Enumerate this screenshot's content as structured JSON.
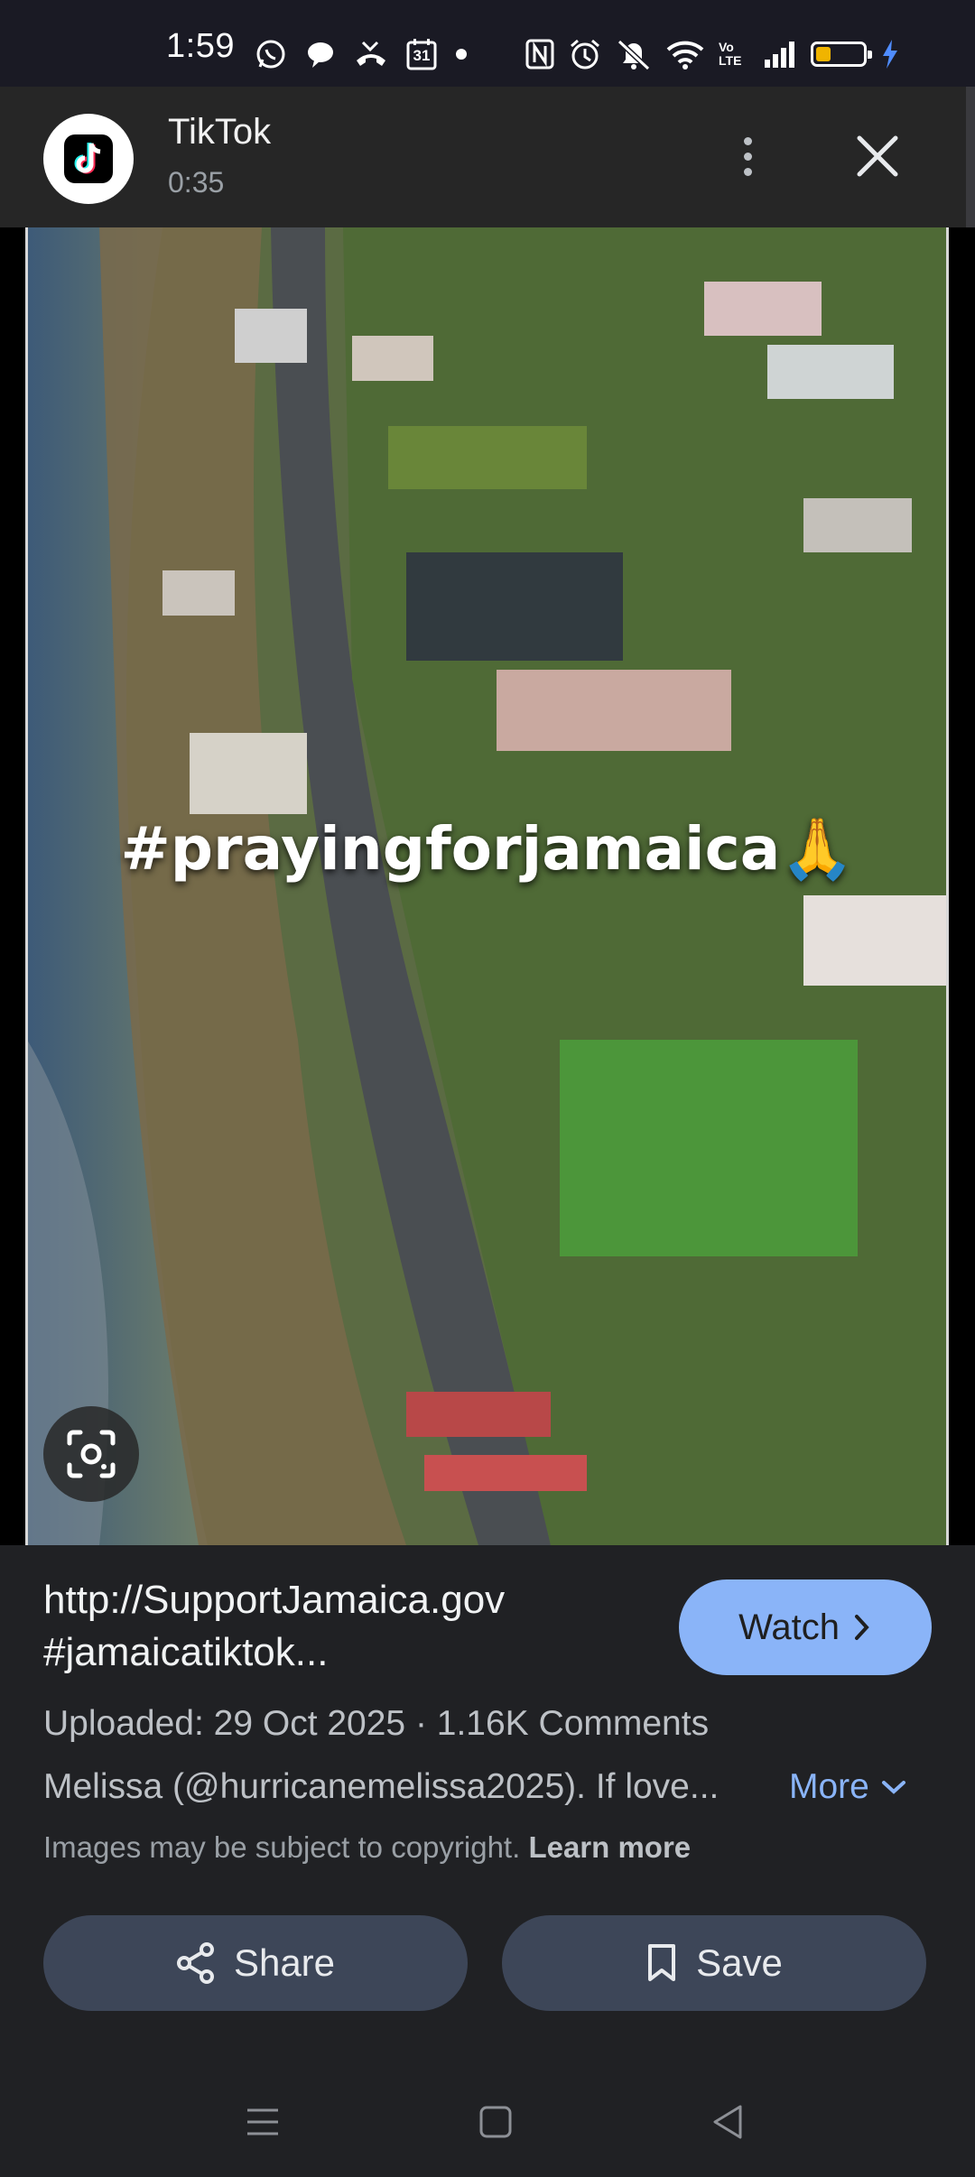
{
  "status": {
    "time": "1:59",
    "calendar_day": "31",
    "network": "Vo LTE"
  },
  "header": {
    "title": "TikTok",
    "subtitle": "0:35"
  },
  "media": {
    "overlay_text": "#prayingforjamaica🙏"
  },
  "info": {
    "title_line1": "http://SupportJamaica.gov",
    "title_line2": "#jamaicatiktok...",
    "watch_label": "Watch",
    "meta": "Uploaded: 29 Oct 2025  ·  1.16K Comments",
    "description": "Melissa (@hurricanemelissa2025). If love...",
    "more_label": "More",
    "copyright_text": "Images may be subject to copyright.",
    "learn_more": "Learn more",
    "share_label": "Share",
    "save_label": "Save"
  },
  "colors": {
    "accent": "#8ab4f8",
    "button_bg": "#3d4658",
    "background": "#202124"
  },
  "icons": [
    "whatsapp-icon",
    "chat-icon",
    "missed-call-icon",
    "calendar-icon",
    "nfc-icon",
    "alarm-icon",
    "mute-icon",
    "wifi-icon",
    "signal-icon",
    "battery-icon",
    "more-vert-icon",
    "close-icon",
    "lens-icon",
    "chevron-right-icon",
    "chevron-down-icon",
    "share-icon",
    "bookmark-icon",
    "menu-icon",
    "home-icon",
    "back-icon"
  ]
}
